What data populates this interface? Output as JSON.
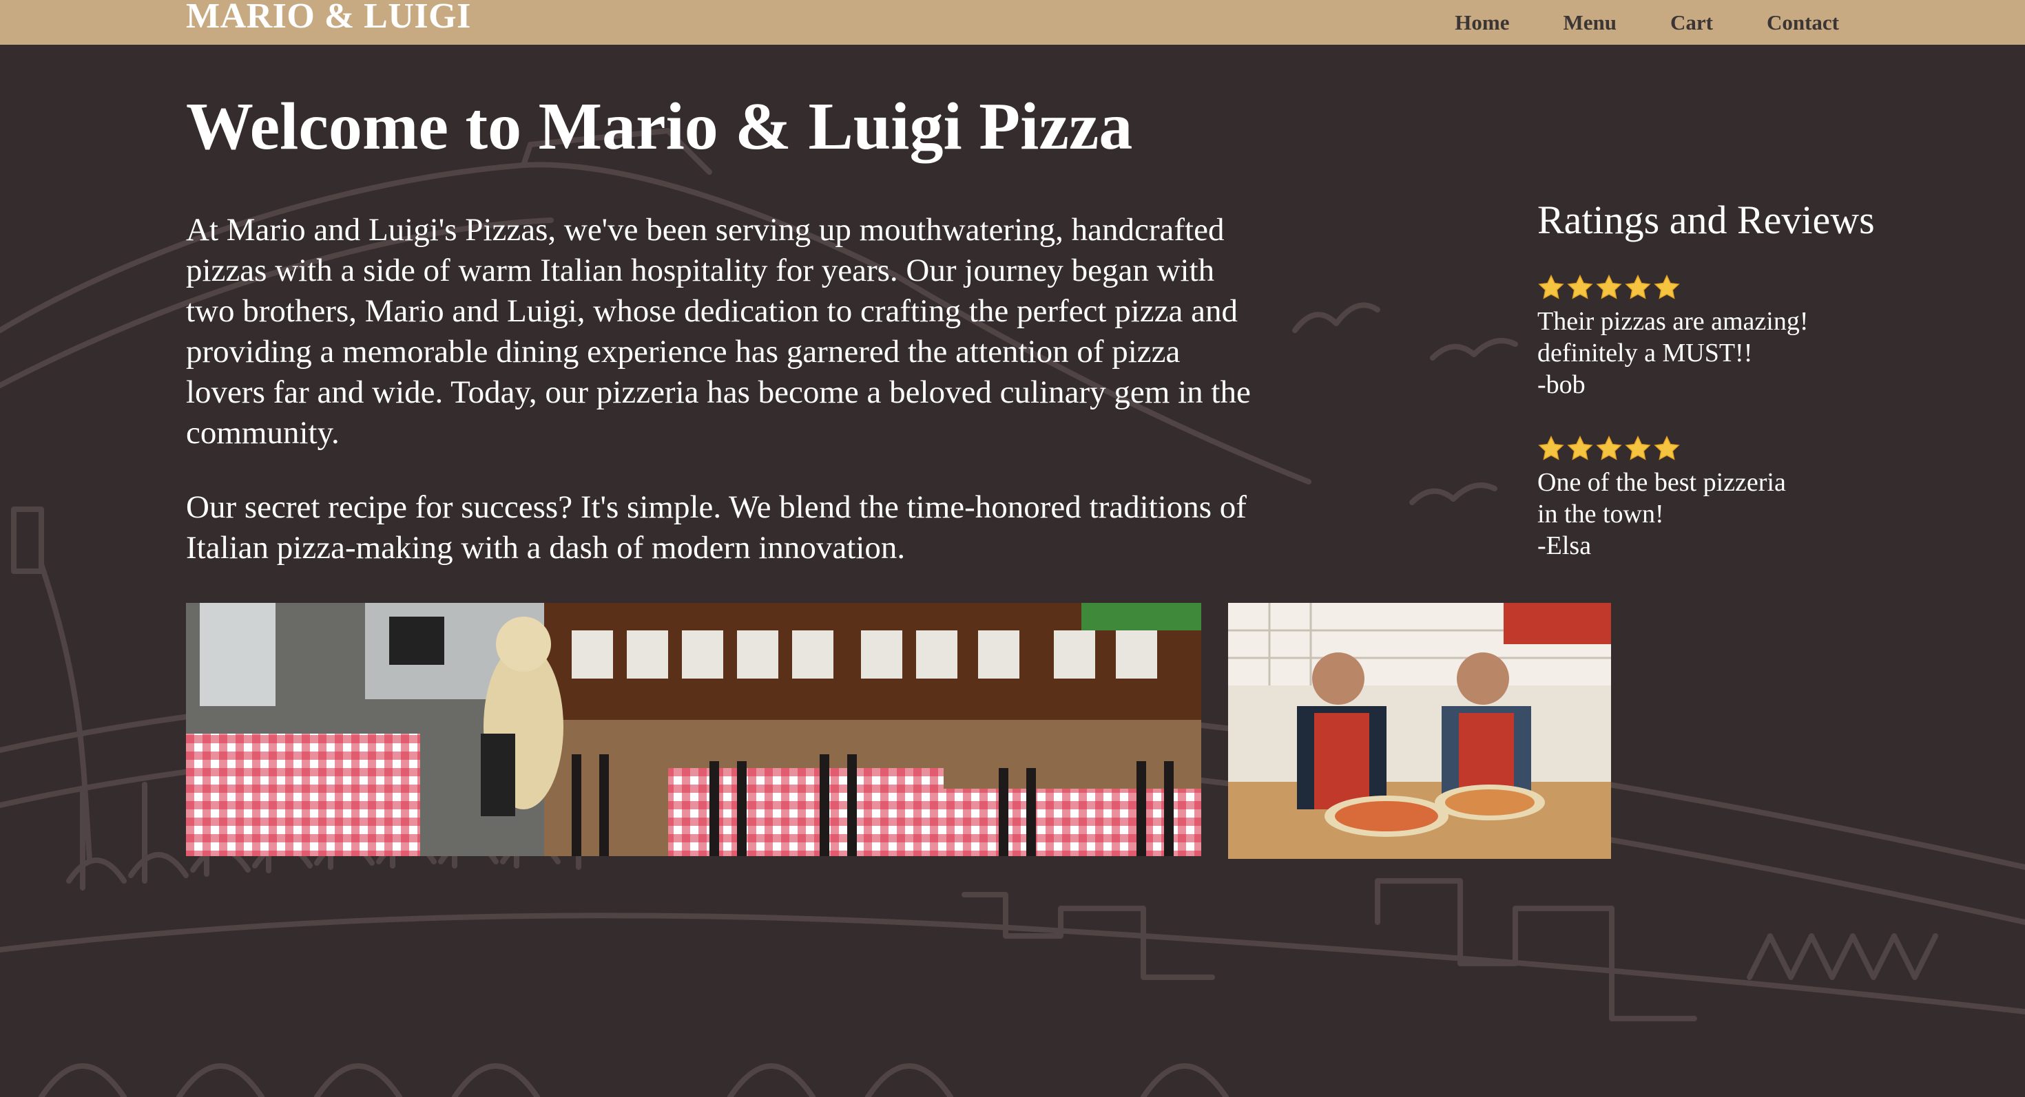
{
  "nav": {
    "brand": "MARIO & LUIGI",
    "links": [
      {
        "label": "Home"
      },
      {
        "label": "Menu"
      },
      {
        "label": "Cart"
      },
      {
        "label": "Contact"
      }
    ]
  },
  "main": {
    "title": "Welcome to Mario & Luigi Pizza",
    "paragraphs": [
      "At Mario and Luigi's Pizzas, we've been serving up mouthwatering, handcrafted pizzas with a side of warm Italian hospitality for years. Our journey began with two brothers, Mario and Luigi, whose dedication to crafting the perfect pizza and providing a memorable dining experience has garnered the attention of pizza lovers far and wide. Today, our pizzeria has become a beloved culinary gem in the community.",
      "Our secret recipe for success? It's simple. We blend the time-honored traditions of Italian pizza-making with a dash of modern innovation."
    ]
  },
  "reviews": {
    "title": "Ratings and Reviews",
    "items": [
      {
        "rating": 5,
        "text": "Their pizzas are amazing!\ndefinitely a MUST!!\n-bob"
      },
      {
        "rating": 5,
        "text": "One of the best pizzeria\nin the town!\n-Elsa"
      }
    ]
  },
  "images": [
    {
      "name": "restaurant-interior-photo"
    },
    {
      "name": "chefs-with-pizza-photo"
    }
  ],
  "colors": {
    "background": "#352c2d",
    "navbar": "#c8aa82",
    "nav_text": "#3b3534",
    "star": "#f5c542"
  }
}
